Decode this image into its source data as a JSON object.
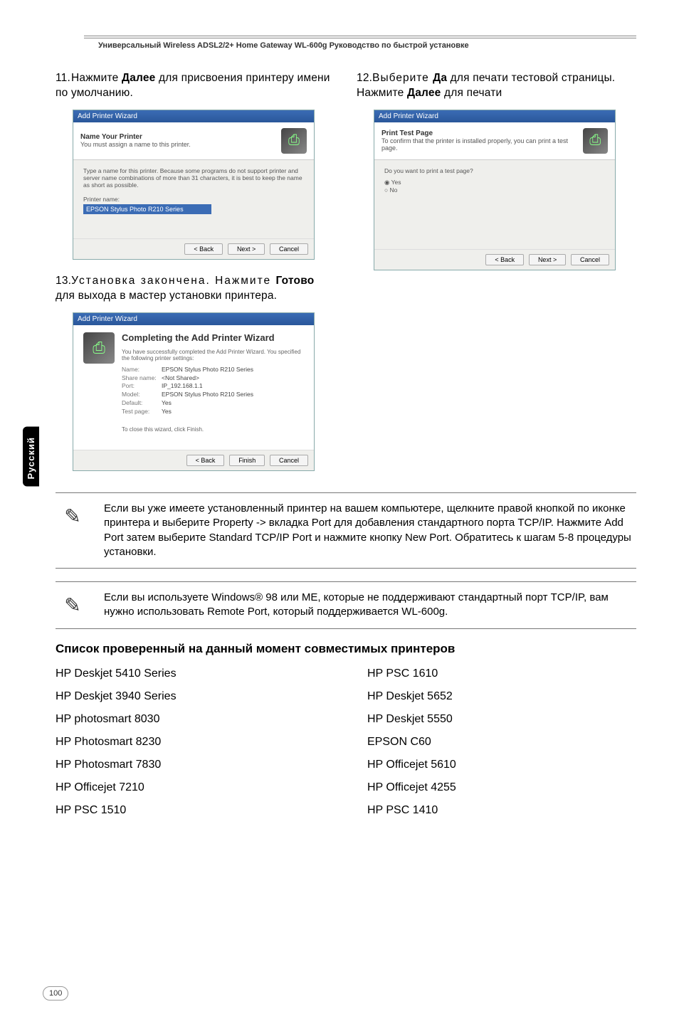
{
  "header": "Универсальный Wireless ADSL2/2+ Home Gateway  WL-600g Руководство по быстрой установке",
  "side_lang": "Русский",
  "step11": {
    "num": "11.",
    "pre": "Нажмите ",
    "bold": "Далее",
    "post": " для присвоения принтеру имени по умолчанию."
  },
  "step12": {
    "num": "12.",
    "pre": "Выберите ",
    "bold1": "Да",
    "mid": " для печати тестовой страницы. Нажмите ",
    "bold2": "Далее",
    "post": " для печати"
  },
  "step13": {
    "num": "13.",
    "pre": "Установка закончена. Нажмите ",
    "bold": "Готово",
    "post": " для выхода в мастер установки принтера."
  },
  "wizard11": {
    "title": "Add Printer Wizard",
    "head_title": "Name Your Printer",
    "head_sub": "You must assign a name to this printer.",
    "body_text": "Type a name for this printer. Because some programs do not support printer and server name combinations of more than 31 characters, it is best to keep the name as short as possible.",
    "field_label": "Printer name:",
    "field_value": "EPSON Stylus Photo R210 Series",
    "btn_back": "< Back",
    "btn_next": "Next >",
    "btn_cancel": "Cancel"
  },
  "wizard12": {
    "title": "Add Printer Wizard",
    "head_title": "Print Test Page",
    "head_sub": "To confirm that the printer is installed properly, you can print a test page.",
    "body_q": "Do you want to print a test page?",
    "opt_yes": "Yes",
    "opt_no": "No",
    "btn_back": "< Back",
    "btn_next": "Next >",
    "btn_cancel": "Cancel"
  },
  "wizard13": {
    "title": "Add Printer Wizard",
    "comp_title": "Completing the Add Printer Wizard",
    "comp_sub": "You have successfully completed the Add Printer Wizard. You specified the following printer settings:",
    "rows": [
      {
        "k": "Name:",
        "v": "EPSON Stylus Photo R210 Series"
      },
      {
        "k": "Share name:",
        "v": "<Not Shared>"
      },
      {
        "k": "Port:",
        "v": "IP_192.168.1.1"
      },
      {
        "k": "Model:",
        "v": "EPSON Stylus Photo R210 Series"
      },
      {
        "k": "Default:",
        "v": "Yes"
      },
      {
        "k": "Test page:",
        "v": "Yes"
      }
    ],
    "close_text": "To close this wizard, click Finish.",
    "btn_back": "< Back",
    "btn_finish": "Finish",
    "btn_cancel": "Cancel"
  },
  "note1": "Если вы уже имеете установленный принтер на вашем компьютере, щелкните правой кнопкой по иконке принтера и выберите Property -> вкладка Port для добавления стандартного порта TCP/IP. Нажмите Add Port затем выберите Standard TCP/IP Port и нажмите кнопку New Port. Обратитесь к шагам 5-8 процедуры установки.",
  "note2": "Если вы используете Windows® 98 или ME, которые не поддерживают стандартный порт TCP/IP, вам нужно использовать Remote Port, который поддерживается WL-600g.",
  "section_title": "Список проверенный на данный момент совместимых принтеров",
  "printers_left": [
    "HP Deskjet 5410 Series",
    "HP Deskjet 3940 Series",
    "HP photosmart 8030",
    "HP Photosmart 8230",
    "HP Photosmart 7830",
    "HP Officejet  7210",
    "HP PSC 1510"
  ],
  "printers_right": [
    "HP PSC 1610",
    "HP Deskjet 5652",
    "HP Deskjet 5550",
    "EPSON C60",
    "HP Officejet 5610",
    "HP Officejet 4255",
    "HP  PSC 1410"
  ],
  "page_num": "100"
}
